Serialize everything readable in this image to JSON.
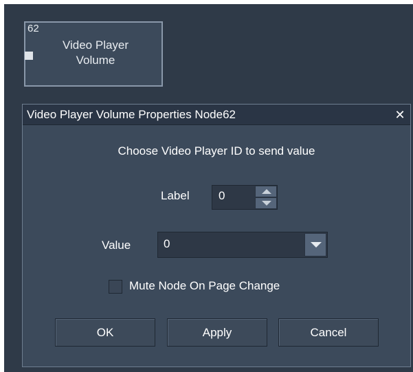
{
  "node": {
    "id": "62",
    "title_line1": "Video Player",
    "title_line2": "Volume"
  },
  "dialog": {
    "title": "Video Player Volume Properties Node62",
    "close_glyph": "✕",
    "instruction": "Choose Video Player ID to send value",
    "label_caption": "Label",
    "label_value": "0",
    "value_caption": "Value",
    "value_selected": "0",
    "mute_label": "Mute Node On Page Change",
    "mute_checked": false,
    "buttons": {
      "ok": "OK",
      "apply": "Apply",
      "cancel": "Cancel"
    }
  },
  "colors": {
    "canvas": "#2f3a48",
    "panel": "#3c4a5b",
    "titlebar": "#2a3545",
    "text": "#ffffff"
  },
  "icons": {
    "close": "close-icon",
    "spin_up": "chevron-up-icon",
    "spin_down": "chevron-down-icon",
    "dropdown": "chevron-down-icon"
  }
}
